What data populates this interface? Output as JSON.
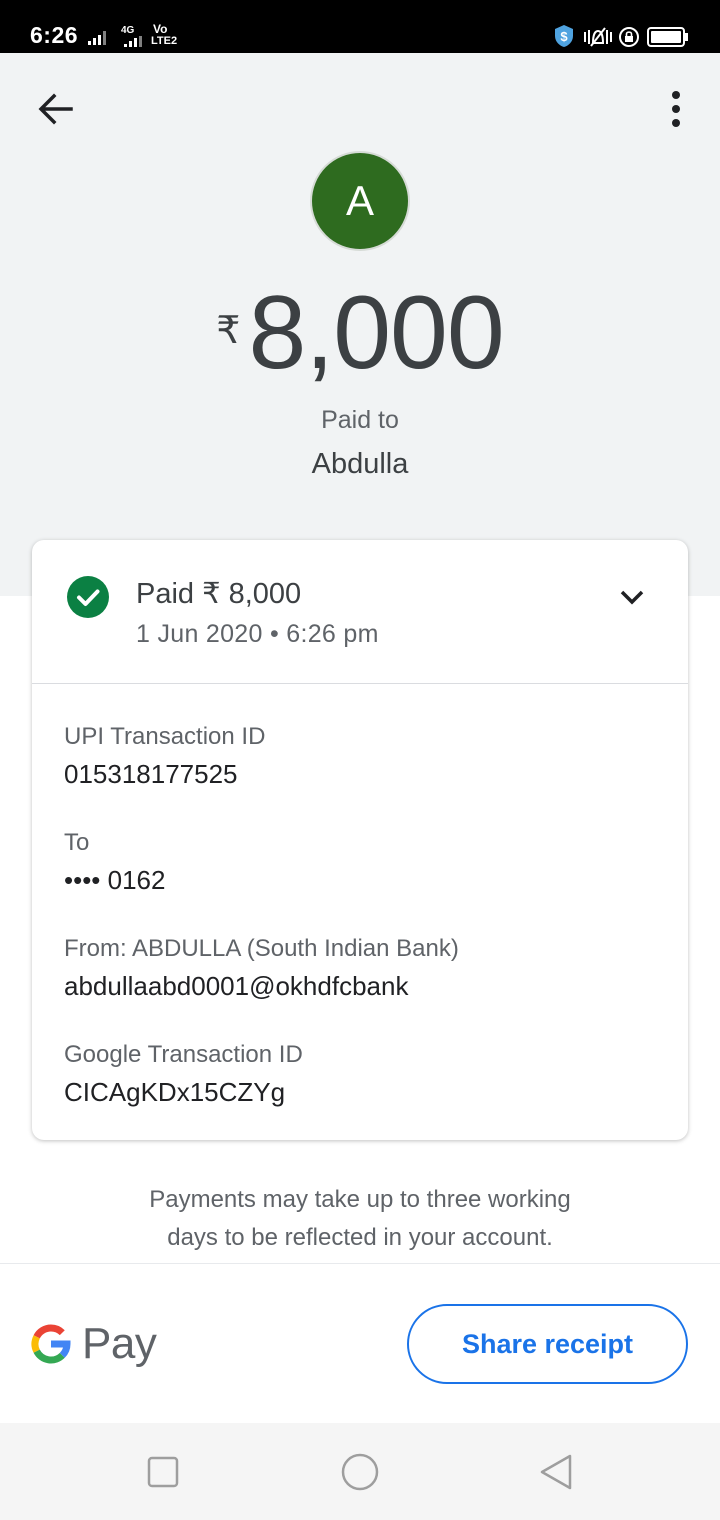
{
  "status_bar": {
    "time": "6:26",
    "net_label": "4G",
    "volte_top": "Vo",
    "volte_bottom": "LTE2"
  },
  "header": {
    "back_icon": "arrow-left-icon",
    "more_icon": "more-vert-icon"
  },
  "summary": {
    "avatar_letter": "A",
    "avatar_color": "#2e6b1f",
    "currency_symbol": "₹",
    "amount": "8,000",
    "paid_to_label": "Paid to",
    "payee_name": "Abdulla"
  },
  "card": {
    "status_icon": "check-circle-icon",
    "status_color": "#0b8043",
    "paid_text": "Paid ₹ 8,000",
    "date_time": "1 Jun 2020 • 6:26 pm",
    "details": [
      {
        "label": "UPI Transaction ID",
        "value": "015318177525"
      },
      {
        "label": "To",
        "value": "•••• 0162"
      },
      {
        "label": "From: ABDULLA (South Indian Bank)",
        "value": "abdullaabd0001@okhdfcbank"
      },
      {
        "label": "Google Transaction ID",
        "value": "CICAgKDx15CZYg"
      }
    ]
  },
  "note": {
    "line1": "Payments may take up to three working",
    "line2": "days to be reflected in your account."
  },
  "footer": {
    "brand_text": "Pay",
    "share_label": "Share receipt",
    "accent_color": "#1a73e8"
  }
}
